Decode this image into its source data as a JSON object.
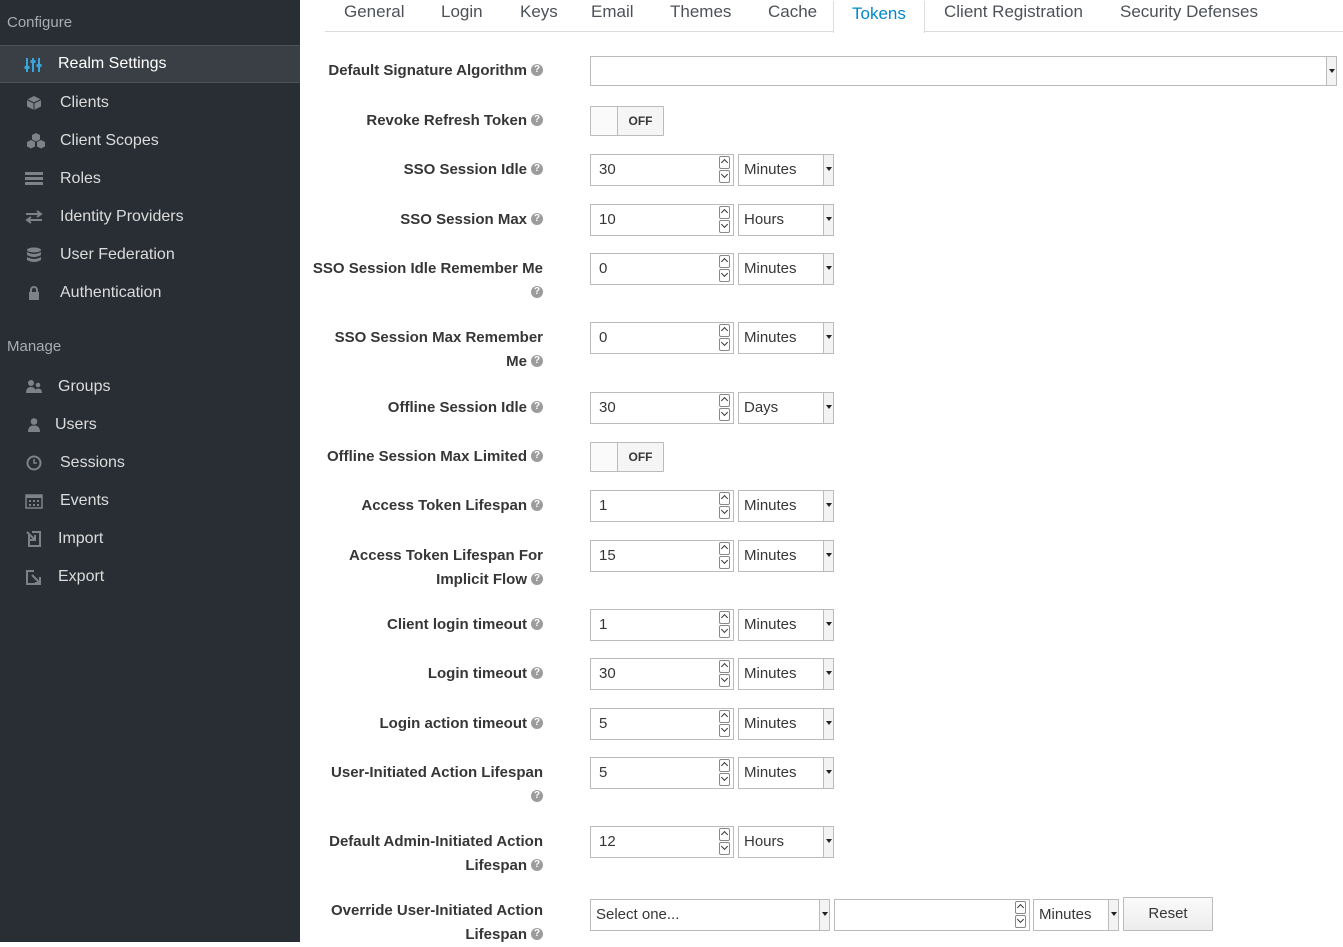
{
  "sidebar": {
    "configure_title": "Configure",
    "manage_title": "Manage",
    "configure_items": [
      {
        "label": "Realm Settings",
        "icon": "sliders-icon"
      },
      {
        "label": "Clients",
        "icon": "cube-icon"
      },
      {
        "label": "Client Scopes",
        "icon": "cubes-icon"
      },
      {
        "label": "Roles",
        "icon": "list-icon"
      },
      {
        "label": "Identity Providers",
        "icon": "exchange-icon"
      },
      {
        "label": "User Federation",
        "icon": "database-icon"
      },
      {
        "label": "Authentication",
        "icon": "lock-icon"
      }
    ],
    "manage_items": [
      {
        "label": "Groups",
        "icon": "users-icon"
      },
      {
        "label": "Users",
        "icon": "user-icon"
      },
      {
        "label": "Sessions",
        "icon": "clock-icon"
      },
      {
        "label": "Events",
        "icon": "calendar-icon"
      },
      {
        "label": "Import",
        "icon": "import-icon"
      },
      {
        "label": "Export",
        "icon": "export-icon"
      }
    ],
    "active_item": "Realm Settings"
  },
  "tabs": [
    "General",
    "Login",
    "Keys",
    "Email",
    "Themes",
    "Cache",
    "Tokens",
    "Client Registration",
    "Security Defenses"
  ],
  "active_tab": "Tokens",
  "form": {
    "default_signature_algorithm": {
      "label": "Default Signature Algorithm",
      "value": ""
    },
    "revoke_refresh_token": {
      "label": "Revoke Refresh Token",
      "state": "OFF"
    },
    "sso_session_idle": {
      "label": "SSO Session Idle",
      "value": "30",
      "unit": "Minutes"
    },
    "sso_session_max": {
      "label": "SSO Session Max",
      "value": "10",
      "unit": "Hours"
    },
    "sso_session_idle_remember_me": {
      "label_line1": "SSO Session Idle Remember Me",
      "value": "0",
      "unit": "Minutes"
    },
    "sso_session_max_remember_me": {
      "label_line1": "SSO Session Max Remember",
      "label_line2": "Me",
      "value": "0",
      "unit": "Minutes"
    },
    "offline_session_idle": {
      "label": "Offline Session Idle",
      "value": "30",
      "unit": "Days"
    },
    "offline_session_max_limited": {
      "label": "Offline Session Max Limited",
      "state": "OFF"
    },
    "access_token_lifespan": {
      "label": "Access Token Lifespan",
      "value": "1",
      "unit": "Minutes"
    },
    "access_token_lifespan_implicit": {
      "label_line1": "Access Token Lifespan For",
      "label_line2": "Implicit Flow",
      "value": "15",
      "unit": "Minutes"
    },
    "client_login_timeout": {
      "label": "Client login timeout",
      "value": "1",
      "unit": "Minutes"
    },
    "login_timeout": {
      "label": "Login timeout",
      "value": "30",
      "unit": "Minutes"
    },
    "login_action_timeout": {
      "label": "Login action timeout",
      "value": "5",
      "unit": "Minutes"
    },
    "user_initiated_action_lifespan": {
      "label_line1": "User-Initiated Action Lifespan",
      "value": "5",
      "unit": "Minutes"
    },
    "default_admin_initiated_action_lifespan": {
      "label_line1": "Default Admin-Initiated Action",
      "label_line2": "Lifespan",
      "value": "12",
      "unit": "Hours"
    },
    "override_user_initiated_action_lifespan": {
      "label_line1": "Override User-Initiated Action",
      "label_line2": "Lifespan",
      "select_placeholder": "Select one...",
      "value": "",
      "unit": "Minutes",
      "reset_label": "Reset"
    }
  },
  "help_glyph": "?"
}
